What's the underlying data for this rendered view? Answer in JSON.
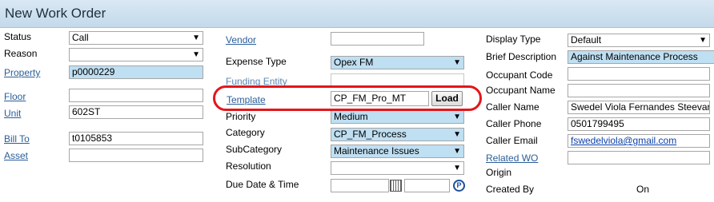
{
  "title": "New Work Order",
  "col1": {
    "status_label": "Status",
    "status_value": "Call",
    "reason_label": "Reason",
    "reason_value": "",
    "property_label": "Property",
    "property_value": "p0000229",
    "floor_label": "Floor",
    "floor_value": "",
    "unit_label": "Unit",
    "unit_value": "602ST",
    "bill_to_label": "Bill To",
    "bill_to_value": "t0105853",
    "asset_label": "Asset",
    "asset_value": ""
  },
  "col2": {
    "vendor_label": "Vendor",
    "vendor_value": "",
    "expense_type_label": "Expense Type",
    "expense_type_value": "Opex FM",
    "funding_entity_label": "Funding Entity",
    "template_label": "Template",
    "template_value": "CP_FM_Pro_MT",
    "load_button": "Load",
    "priority_label": "Priority",
    "priority_value": "Medium",
    "category_label": "Category",
    "category_value": "CP_FM_Process",
    "subcategory_label": "SubCategory",
    "subcategory_value": "Maintenance Issues",
    "resolution_label": "Resolution",
    "resolution_value": "",
    "due_label": "Due Date & Time",
    "due_date": "",
    "due_time": ""
  },
  "col3": {
    "display_type_label": "Display Type",
    "display_type_value": "Default",
    "brief_label": "Brief Description",
    "brief_value": "Against Maintenance Process",
    "occ_code_label": "Occupant Code",
    "occ_code_value": "",
    "occ_name_label": "Occupant Name",
    "occ_name_value": "",
    "caller_name_label": "Caller Name",
    "caller_name_value": "Swedel Viola Fernandes Steevar",
    "caller_phone_label": "Caller Phone",
    "caller_phone_value": "0501799495",
    "caller_email_label": "Caller Email",
    "caller_email_value": "fswedelviola@gmail.com",
    "related_wo_label": "Related WO",
    "related_wo_value": "",
    "origin_label": "Origin",
    "created_by_label": "Created By",
    "created_on_label": "On"
  },
  "colors": {
    "highlight": "#e3161b",
    "field_blue": "#bfdff2",
    "link": "#2a5e99",
    "title_bg": "#c4d9ea"
  }
}
